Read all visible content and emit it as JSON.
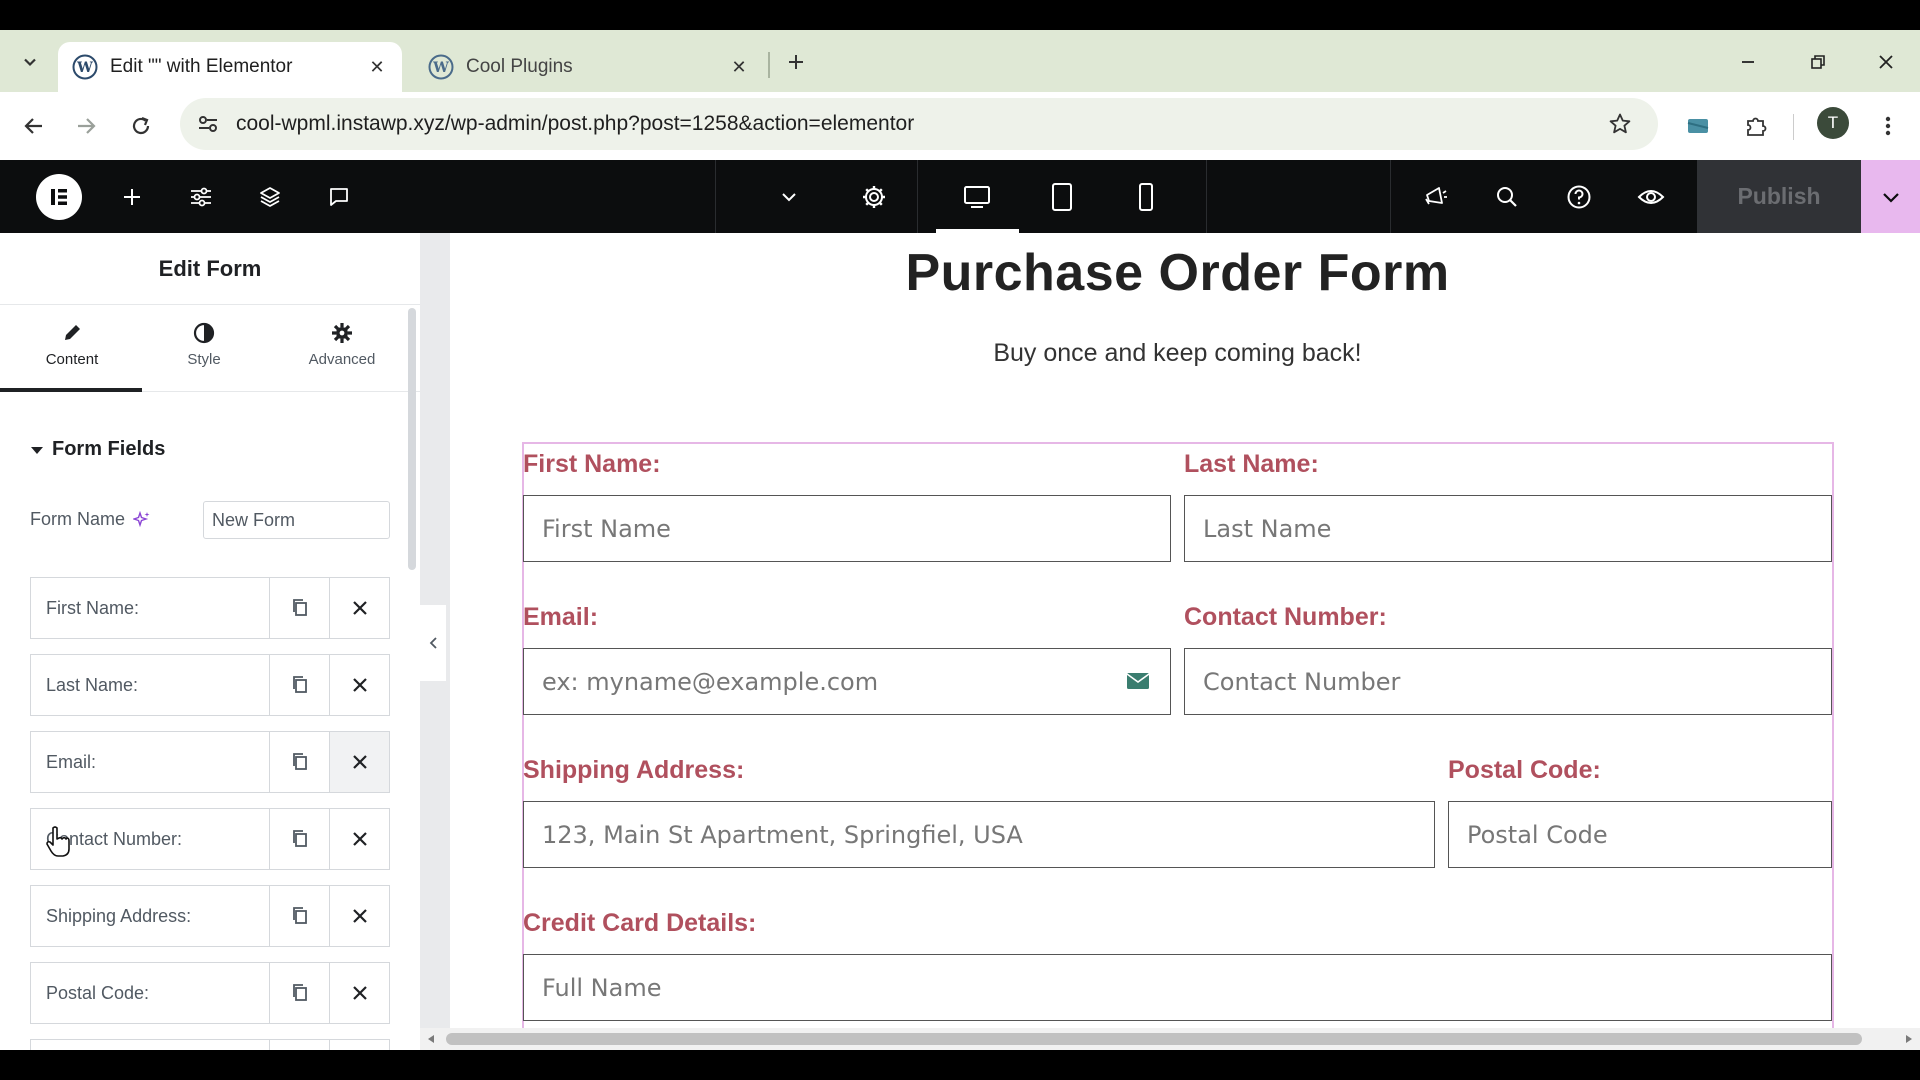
{
  "browser": {
    "tabs": [
      {
        "label": "Edit \"\" with Elementor",
        "active": true
      },
      {
        "label": "Cool Plugins",
        "active": false
      }
    ],
    "url": "cool-wpml.instawp.xyz/wp-admin/post.php?post=1258&action=elementor",
    "profile_initial": "T"
  },
  "elementor": {
    "publish_label": "Publish",
    "accent_color": "#e8b8ee"
  },
  "panel": {
    "title": "Edit Form",
    "tabs": [
      "Content",
      "Style",
      "Advanced"
    ],
    "section": "Form Fields",
    "form_name_label": "Form Name",
    "form_name_value": "New Form",
    "fields": [
      "First Name:",
      "Last Name:",
      "Email:",
      "Contact Number:",
      "Shipping Address:",
      "Postal Code:"
    ]
  },
  "canvas": {
    "title": "Purchase Order Form",
    "subtitle": "Buy once and keep coming back!",
    "labels": {
      "first_name": "First Name:",
      "last_name": "Last Name:",
      "email": "Email:",
      "contact": "Contact Number:",
      "shipping": "Shipping Address:",
      "postal": "Postal Code:",
      "card": "Credit Card Details:"
    },
    "placeholders": {
      "first_name": "First Name",
      "last_name": "Last Name",
      "email": "ex: myname@example.com",
      "contact": "Contact Number",
      "shipping": "123, Main St Apartment, Springfiel, USA",
      "postal": "Postal Code",
      "card": "Full Name"
    },
    "label_color": "#b0505e"
  }
}
